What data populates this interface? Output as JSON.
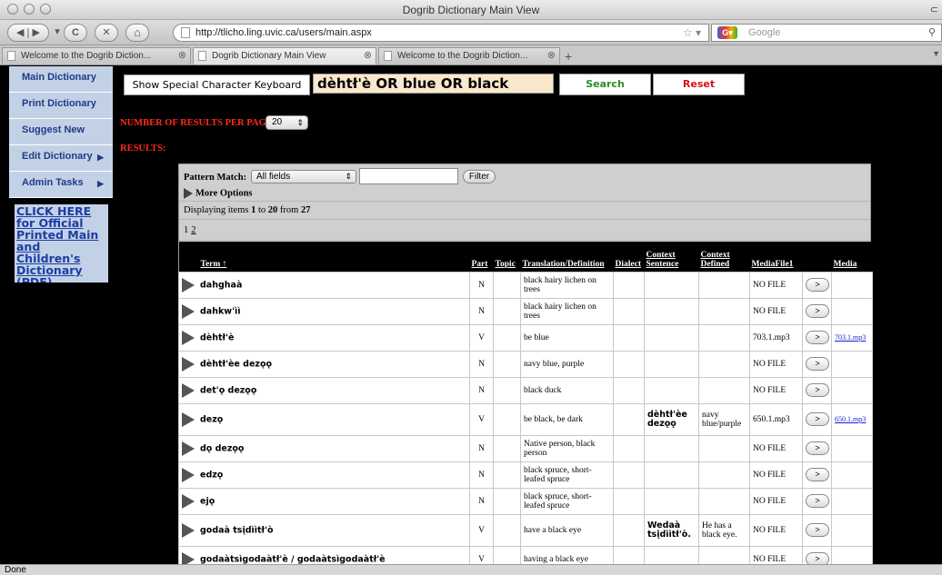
{
  "window": {
    "title": "Dogrib Dictionary Main View",
    "status": "Done"
  },
  "toolbar": {
    "url": "http://tlicho.ling.uvic.ca/users/main.aspx",
    "search_engine_placeholder": "Google",
    "back": "◀",
    "forward": "▶",
    "reload": "C",
    "stop": "✕",
    "home": "⌂"
  },
  "tabs": [
    {
      "label": "Welcome to the Dogrib Diction..."
    },
    {
      "label": "Dogrib Dictionary Main View"
    },
    {
      "label": "Welcome to the Dogrib Diction..."
    }
  ],
  "sidebar": {
    "items": [
      {
        "label": "Main Dictionary",
        "arrow": ""
      },
      {
        "label": "Print Dictionary",
        "arrow": ""
      },
      {
        "label": "Suggest New",
        "arrow": ""
      },
      {
        "label": "Edit Dictionary",
        "arrow": "▶"
      },
      {
        "label": "Admin Tasks",
        "arrow": "▶"
      }
    ],
    "promo": "CLICK HERE for Official Printed Main and Children's Dictionary (PDF)"
  },
  "search": {
    "keyboard_button": "Show Special Character Keyboard",
    "query": "dèhtł'è OR blue OR black",
    "search_button": "Search",
    "reset_button": "Reset",
    "results_per_page_label": "NUMBER OF RESULTS PER PAGE:",
    "results_per_page_value": "20",
    "results_label": "RESULTS:"
  },
  "filter": {
    "pattern_label": "Pattern Match:",
    "pattern_value": "All fields",
    "filter_button": "Filter",
    "more_options": "More Options",
    "display_prefix": "Displaying items ",
    "display_from": "1",
    "display_to_word": " to ",
    "display_to": "20",
    "display_from_word": " from ",
    "display_total": "27",
    "pages": [
      "1",
      "2"
    ]
  },
  "table": {
    "headers": [
      "Term ↑",
      "Part",
      "Topic",
      "Translation/Definition",
      "Dialect",
      "Context Sentence",
      "Context Defined",
      "MediaFile1",
      "",
      "Media"
    ],
    "rows": [
      {
        "term": "dahghaà",
        "part": "N",
        "topic": "",
        "def": "black hairy lichen on trees",
        "dialect": "",
        "ctx": "",
        "ctxdef": "",
        "media": "NO FILE",
        "play": ">",
        "link": ""
      },
      {
        "term": "dahkw'ìì",
        "part": "N",
        "topic": "",
        "def": "black hairy lichen on trees",
        "dialect": "",
        "ctx": "",
        "ctxdef": "",
        "media": "NO FILE",
        "play": ">",
        "link": ""
      },
      {
        "term": "dèhtł'è",
        "part": "V",
        "topic": "",
        "def": "be blue",
        "dialect": "",
        "ctx": "",
        "ctxdef": "",
        "media": "703.1.mp3",
        "play": ">",
        "link": "703.1.mp3"
      },
      {
        "term": "dèhtł'èe dezǫǫ",
        "part": "N",
        "topic": "",
        "def": "navy blue, purple",
        "dialect": "",
        "ctx": "",
        "ctxdef": "",
        "media": "NO FILE",
        "play": ">",
        "link": ""
      },
      {
        "term": "det'ǫ dezǫǫ",
        "part": "N",
        "topic": "",
        "def": "black duck",
        "dialect": "",
        "ctx": "",
        "ctxdef": "",
        "media": "NO FILE",
        "play": ">",
        "link": ""
      },
      {
        "term": "dezǫ",
        "part": "V",
        "topic": "",
        "def": "be black, be dark",
        "dialect": "",
        "ctx": "dèhtł'èe dezǫǫ",
        "ctxdef": "navy blue/purple",
        "media": "650.1.mp3",
        "play": ">",
        "link": "650.1.mp3"
      },
      {
        "term": "dǫ dezǫǫ",
        "part": "N",
        "topic": "",
        "def": "Native person, black person",
        "dialect": "",
        "ctx": "",
        "ctxdef": "",
        "media": "NO FILE",
        "play": ">",
        "link": ""
      },
      {
        "term": "edzǫ",
        "part": "N",
        "topic": "",
        "def": "black spruce, short-leafed spruce",
        "dialect": "",
        "ctx": "",
        "ctxdef": "",
        "media": "NO FILE",
        "play": ">",
        "link": ""
      },
      {
        "term": "ejǫ",
        "part": "N",
        "topic": "",
        "def": "black spruce, short-leafed spruce",
        "dialect": "",
        "ctx": "",
        "ctxdef": "",
        "media": "NO FILE",
        "play": ">",
        "link": ""
      },
      {
        "term": "godaà tsįdììtł'ò",
        "part": "V",
        "topic": "",
        "def": "have a black eye",
        "dialect": "",
        "ctx": "Wedaà tsįdììtł'ò.",
        "ctxdef": "He has a black eye.",
        "media": "NO FILE",
        "play": ">",
        "link": ""
      },
      {
        "term": "godaàtsìgodaàtł'è / godaàtsìgodaàtł'è",
        "part": "V",
        "topic": "",
        "def": "having a black eye",
        "dialect": "",
        "ctx": "",
        "ctxdef": "",
        "media": "NO FILE",
        "play": ">",
        "link": ""
      }
    ]
  }
}
